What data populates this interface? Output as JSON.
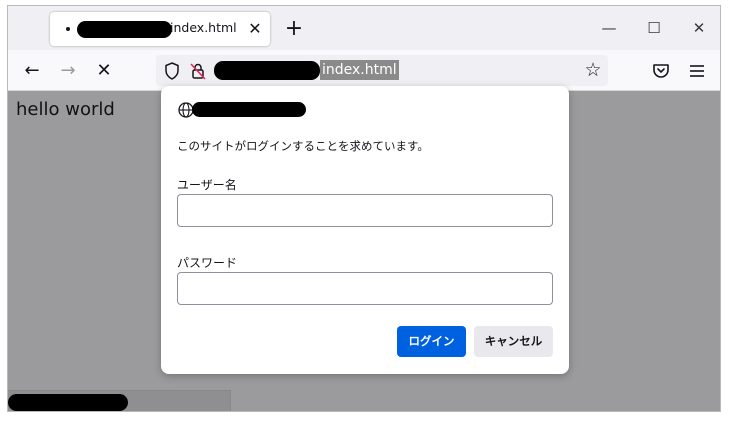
{
  "browser": {
    "tab": {
      "title_suffix": "index.html",
      "close_glyph": "✕"
    },
    "new_tab_glyph": "+",
    "window_controls": {
      "minimize": "—",
      "maximize": "☐",
      "close": "✕"
    },
    "nav": {
      "back_glyph": "←",
      "forward_glyph": "→",
      "stop_glyph": "✕"
    },
    "urlbar": {
      "url_suffix": "index.html",
      "bookmark_glyph": "☆"
    }
  },
  "page": {
    "body_text": "hello world"
  },
  "auth_dialog": {
    "message": "このサイトがログインすることを求めています。",
    "username_label": "ユーザー名",
    "username_value": "",
    "password_label": "パスワード",
    "password_value": "",
    "login_button": "ログイン",
    "cancel_button": "キャンセル"
  },
  "colors": {
    "primary_button": "#0061e0",
    "overlay": "#9b9b9e"
  }
}
